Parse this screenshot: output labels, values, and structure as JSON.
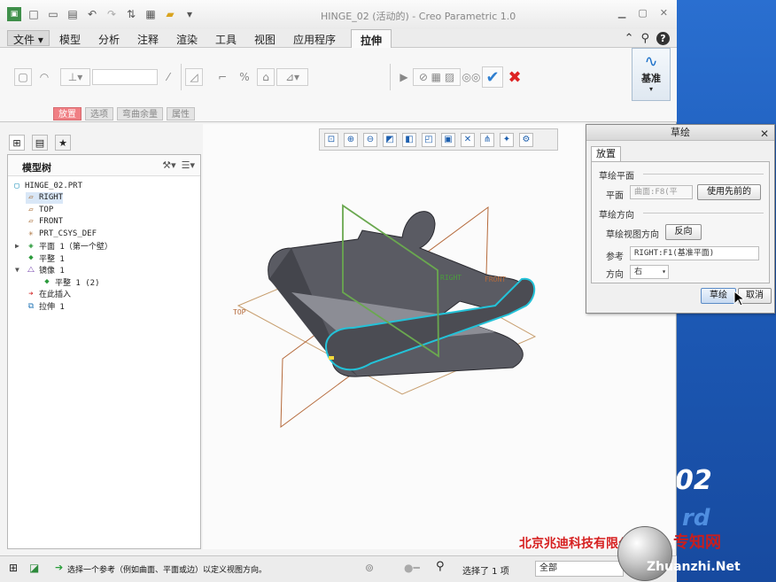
{
  "window": {
    "title": "HINGE_02 (活动的) - Creo Parametric 1.0"
  },
  "menubar": {
    "file": "文件",
    "items": [
      "模型",
      "分析",
      "注释",
      "渲染",
      "工具",
      "视图",
      "应用程序"
    ],
    "active": "拉伸"
  },
  "ribbon": {
    "datum_label": "基准",
    "subtabs": [
      "放置",
      "选项",
      "弯曲余量",
      "属性"
    ]
  },
  "model_tree": {
    "title": "模型树",
    "nodes": [
      {
        "label": "HINGE_02.PRT",
        "level": 0,
        "icon": "part-icon"
      },
      {
        "label": "RIGHT",
        "level": 1,
        "icon": "datum-plane-icon",
        "selected": true
      },
      {
        "label": "TOP",
        "level": 1,
        "icon": "datum-plane-icon"
      },
      {
        "label": "FRONT",
        "level": 1,
        "icon": "datum-plane-icon"
      },
      {
        "label": "PRT_CSYS_DEF",
        "level": 1,
        "icon": "csys-icon"
      },
      {
        "label": "平面 1（第一个壁）",
        "level": 1,
        "icon": "sheetmetal-wall-icon",
        "expandable": true
      },
      {
        "label": "平整 1",
        "level": 1,
        "icon": "flat-wall-icon"
      },
      {
        "label": "镜像 1",
        "level": 1,
        "icon": "mirror-icon",
        "expanded": true
      },
      {
        "label": "平整 1 (2)",
        "level": 2,
        "icon": "flat-wall-icon"
      },
      {
        "label": "在此插入",
        "level": 1,
        "icon": "insert-here-icon"
      },
      {
        "label": "拉伸 1",
        "level": 1,
        "icon": "extrude-icon"
      }
    ]
  },
  "viewport": {
    "plane_labels": [
      "RIGHT",
      "FRONT",
      "TOP"
    ]
  },
  "sketch_dialog": {
    "title": "草绘",
    "tab": "放置",
    "section_plane": "草绘平面",
    "plane_label": "平面",
    "plane_value": "曲面:F8(平",
    "use_previous": "使用先前的",
    "section_orient": "草绘方向",
    "view_dir_label": "草绘视图方向",
    "flip": "反向",
    "reference_label": "参考",
    "reference_value": "RIGHT:F1(基准平面)",
    "orientation_label": "方向",
    "orientation_value": "右",
    "ok": "草绘",
    "cancel": "取消"
  },
  "statusbar": {
    "message": "选择一个参考（例如曲面、平面或边）以定义视图方向。",
    "selection": "选择了 1 项",
    "filter": "全部"
  },
  "watermark": {
    "company": "北京兆迪科技有限公司",
    "site_cn": "专知网",
    "site": "Zhuanzhi.Net"
  },
  "desktop": {
    "logo": "02",
    "ghost": "rd"
  },
  "colors": {
    "accent": "#2f7fd0",
    "active_subtab": "#f07f84",
    "sketch_plane": "#6aa84f",
    "datum_plane": "#b56a3b",
    "part_body": "#55565f"
  }
}
